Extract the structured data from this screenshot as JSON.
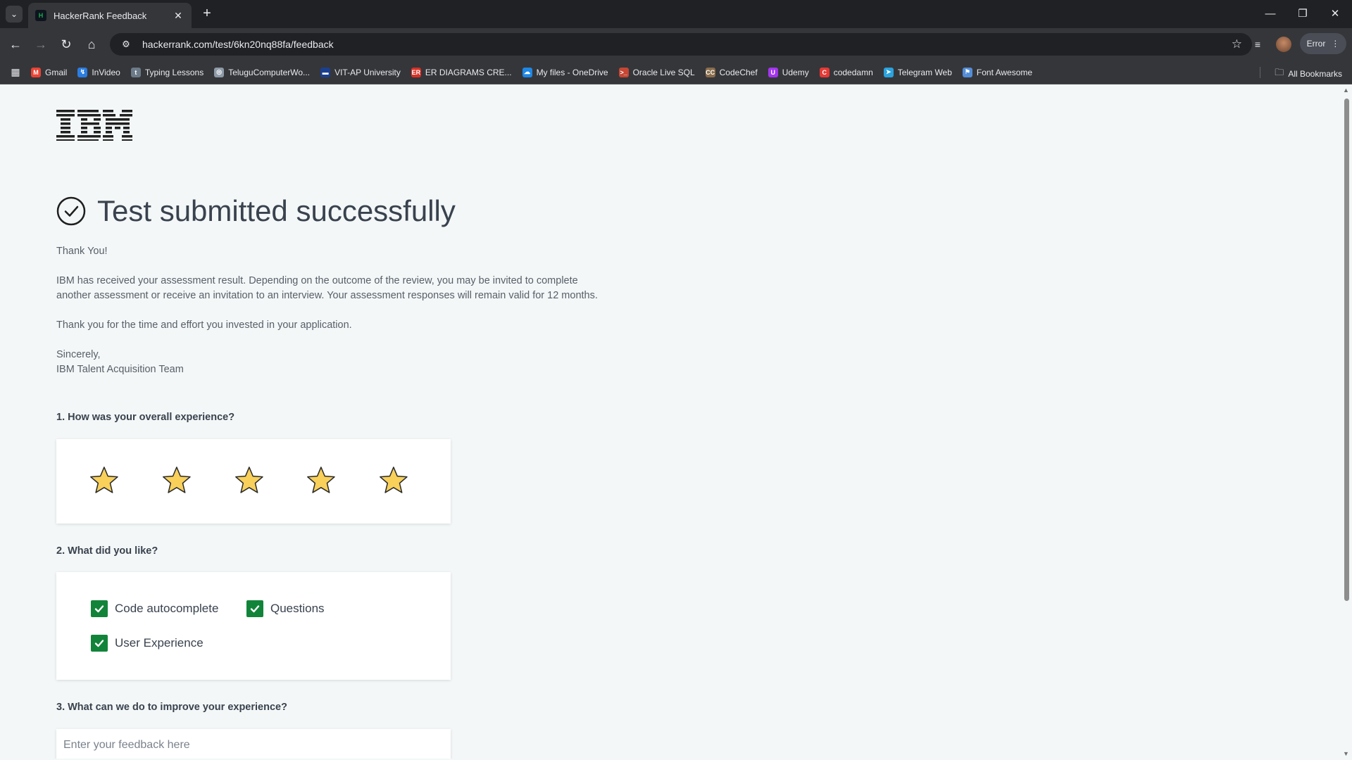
{
  "browser": {
    "tab_title": "HackerRank Feedback",
    "url": "hackerrank.com/test/6kn20nq88fa/feedback",
    "profile_status": "Error",
    "bookmarks": [
      {
        "label": "Gmail",
        "color": "#ea4335",
        "icon": "M"
      },
      {
        "label": "InVideo",
        "color": "#2a7de1",
        "icon": "↯"
      },
      {
        "label": "Typing Lessons",
        "color": "#6c7a89",
        "icon": "t"
      },
      {
        "label": "TeluguComputerWo...",
        "color": "#8e9aa8",
        "icon": "◎"
      },
      {
        "label": "VIT-AP University",
        "color": "#1b3f8f",
        "icon": "▬"
      },
      {
        "label": "ER DIAGRAMS CRE...",
        "color": "#d93025",
        "icon": "ER"
      },
      {
        "label": "My files - OneDrive",
        "color": "#1e88e5",
        "icon": "☁"
      },
      {
        "label": "Oracle Live SQL",
        "color": "#c74634",
        "icon": ">_"
      },
      {
        "label": "CodeChef",
        "color": "#8a6d4b",
        "icon": "CC"
      },
      {
        "label": "Udemy",
        "color": "#a435f0",
        "icon": "U"
      },
      {
        "label": "codedamn",
        "color": "#e53935",
        "icon": "C"
      },
      {
        "label": "Telegram Web",
        "color": "#2aa3df",
        "icon": "➤"
      },
      {
        "label": "Font Awesome",
        "color": "#538dd7",
        "icon": "⚑"
      }
    ],
    "all_bookmarks": "All Bookmarks"
  },
  "page": {
    "logo": "IBM",
    "title": "Test submitted successfully",
    "thank_you": "Thank You!",
    "body_line1": "IBM has received your assessment result. Depending on the outcome of the review, you may be invited to complete",
    "body_line2": "another assessment or receive an invitation to an interview. Your assessment responses will remain valid for 12 months.",
    "thanks_time": "Thank you for the time and effort you invested in your application.",
    "sincerely": "Sincerely,",
    "team": "IBM Talent Acquisition Team",
    "q1": "1. How was your overall experience?",
    "rating": 5,
    "rating_max": 5,
    "star_color": "#f8d05a",
    "q2": "2. What did you like?",
    "options": [
      {
        "label": "Code autocomplete",
        "checked": true
      },
      {
        "label": "Questions",
        "checked": true
      },
      {
        "label": "User Experience",
        "checked": true
      }
    ],
    "check_color": "#12843a",
    "q3": "3. What can we do to improve your experience?",
    "feedback_placeholder": "Enter your feedback here"
  }
}
